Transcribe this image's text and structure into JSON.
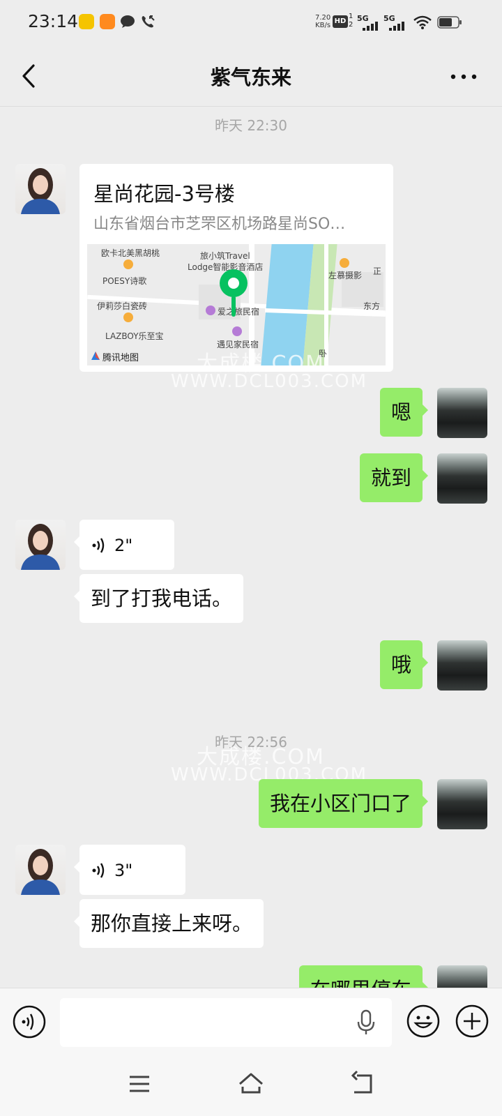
{
  "status_bar": {
    "time": "23:14",
    "net_speed": "7.20",
    "net_unit": "KB/s",
    "hd": "HD",
    "sim1": "1",
    "sim2": "2",
    "gen1": "5G",
    "gen2": "5G"
  },
  "header": {
    "title": "紫气东来"
  },
  "messages": {
    "ts1": "昨天 22:30",
    "location": {
      "name": "星尚花园-3号楼",
      "address": "山东省烟台市芝罘区机场路星尚SO…",
      "map_labels": {
        "l1": "欧卡北美黑胡桃",
        "l2": "旅小筑Travel",
        "l3": "Lodge智能影音酒店",
        "l4": "POESY诗歌",
        "l5": "伊莉莎白瓷砖",
        "l6": "LAZBOY乐至宝",
        "l7": "爱之旅民宿",
        "l8": "遇见家民宿",
        "l9": "左慕摄影",
        "l10": "东方",
        "l11": "正",
        "l12": "卧",
        "logo": "腾讯地图"
      }
    },
    "m1": "嗯",
    "m2": "就到",
    "v1": "2\"",
    "m3": "到了打我电话。",
    "m4": "哦",
    "ts2": "昨天 22:56",
    "m5": "我在小区门口了",
    "v2": "3\"",
    "m6": "那你直接上来呀。",
    "m7": "在哪里停车"
  },
  "watermark": {
    "line1": "大成楼.COM",
    "line2": "WWW.DCL003.COM"
  },
  "input": {
    "placeholder": ""
  },
  "colors": {
    "background": "#ededed",
    "bubble_out": "#95ec69",
    "bubble_in": "#ffffff",
    "timestamp": "#a6a6a6"
  },
  "icons": [
    "back-arrow-icon",
    "more-icon",
    "voice-wave-icon",
    "microphone-icon",
    "emoji-icon",
    "plus-icon",
    "menu-icon",
    "home-icon",
    "back-nav-icon"
  ]
}
